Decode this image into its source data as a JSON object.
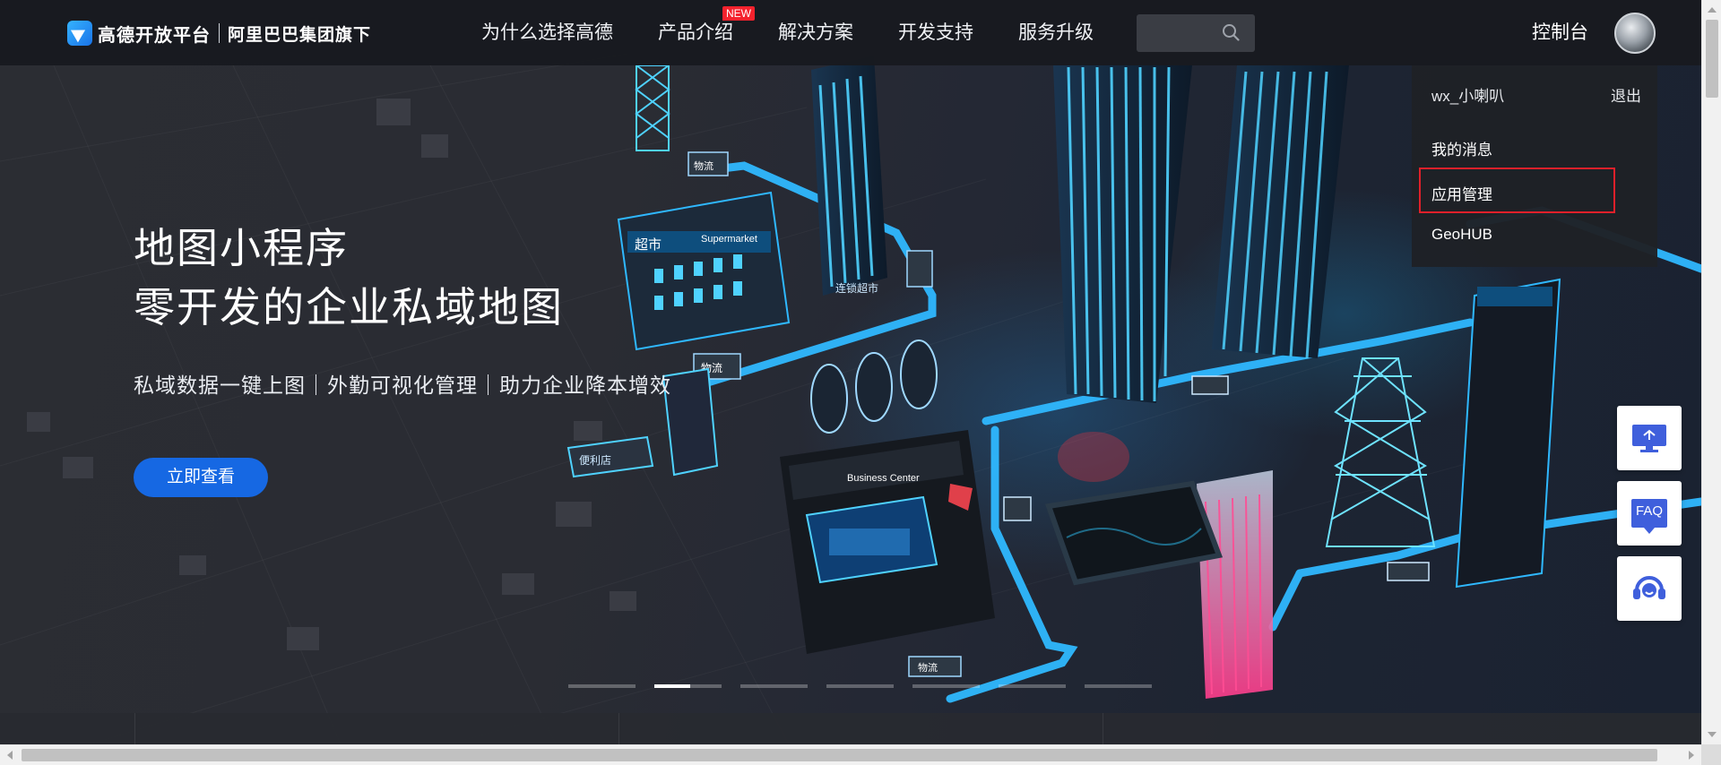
{
  "header": {
    "logo_name": "高德开放平台",
    "logo_sub": "阿里巴巴集团旗下",
    "nav": [
      {
        "label": "为什么选择高德"
      },
      {
        "label": "产品介绍",
        "badge": "NEW"
      },
      {
        "label": "解决方案"
      },
      {
        "label": "开发支持"
      },
      {
        "label": "服务升级"
      }
    ],
    "search_icon": "search-icon",
    "console_label": "控制台"
  },
  "user_menu": {
    "username": "wx_小喇叭",
    "logout_label": "退出",
    "items": [
      "我的消息",
      "应用管理",
      "GeoHUB"
    ],
    "highlighted_item": "应用管理",
    "highlight_color": "#e0202a"
  },
  "hero": {
    "title_line1": "地图小程序",
    "title_line2": "零开发的企业私域地图",
    "subtitle": "私域数据一键上图｜外勤可视化管理｜助力企业降本增效",
    "cta_label": "立即查看",
    "cta_color": "#1668e3",
    "slide_count": 7,
    "active_slide": 2,
    "scene_signs": [
      "超市",
      "Supermarket",
      "连锁超市",
      "物流",
      "物流",
      "便利店",
      "Business Center",
      "物流"
    ]
  },
  "side_buttons": [
    {
      "icon": "monitor-icon"
    },
    {
      "label": "FAQ",
      "icon": "faq-icon"
    },
    {
      "icon": "customer-service-icon"
    }
  ],
  "colors": {
    "accent": "#1668e3",
    "header_bg": "#181a1f",
    "neon": "#2fb8ff"
  }
}
